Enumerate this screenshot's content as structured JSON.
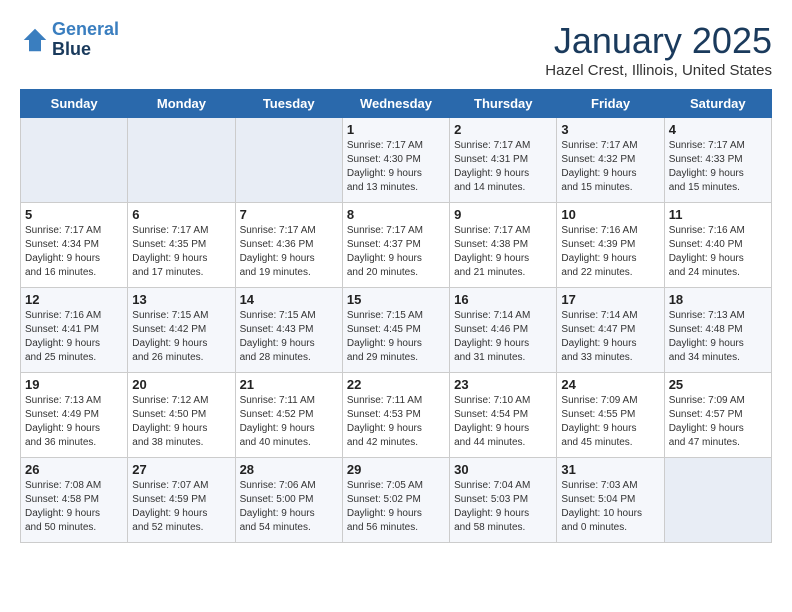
{
  "header": {
    "logo_line1": "General",
    "logo_line2": "Blue",
    "month": "January 2025",
    "location": "Hazel Crest, Illinois, United States"
  },
  "days_of_week": [
    "Sunday",
    "Monday",
    "Tuesday",
    "Wednesday",
    "Thursday",
    "Friday",
    "Saturday"
  ],
  "weeks": [
    [
      {
        "day": "",
        "info": ""
      },
      {
        "day": "",
        "info": ""
      },
      {
        "day": "",
        "info": ""
      },
      {
        "day": "1",
        "info": "Sunrise: 7:17 AM\nSunset: 4:30 PM\nDaylight: 9 hours\nand 13 minutes."
      },
      {
        "day": "2",
        "info": "Sunrise: 7:17 AM\nSunset: 4:31 PM\nDaylight: 9 hours\nand 14 minutes."
      },
      {
        "day": "3",
        "info": "Sunrise: 7:17 AM\nSunset: 4:32 PM\nDaylight: 9 hours\nand 15 minutes."
      },
      {
        "day": "4",
        "info": "Sunrise: 7:17 AM\nSunset: 4:33 PM\nDaylight: 9 hours\nand 15 minutes."
      }
    ],
    [
      {
        "day": "5",
        "info": "Sunrise: 7:17 AM\nSunset: 4:34 PM\nDaylight: 9 hours\nand 16 minutes."
      },
      {
        "day": "6",
        "info": "Sunrise: 7:17 AM\nSunset: 4:35 PM\nDaylight: 9 hours\nand 17 minutes."
      },
      {
        "day": "7",
        "info": "Sunrise: 7:17 AM\nSunset: 4:36 PM\nDaylight: 9 hours\nand 19 minutes."
      },
      {
        "day": "8",
        "info": "Sunrise: 7:17 AM\nSunset: 4:37 PM\nDaylight: 9 hours\nand 20 minutes."
      },
      {
        "day": "9",
        "info": "Sunrise: 7:17 AM\nSunset: 4:38 PM\nDaylight: 9 hours\nand 21 minutes."
      },
      {
        "day": "10",
        "info": "Sunrise: 7:16 AM\nSunset: 4:39 PM\nDaylight: 9 hours\nand 22 minutes."
      },
      {
        "day": "11",
        "info": "Sunrise: 7:16 AM\nSunset: 4:40 PM\nDaylight: 9 hours\nand 24 minutes."
      }
    ],
    [
      {
        "day": "12",
        "info": "Sunrise: 7:16 AM\nSunset: 4:41 PM\nDaylight: 9 hours\nand 25 minutes."
      },
      {
        "day": "13",
        "info": "Sunrise: 7:15 AM\nSunset: 4:42 PM\nDaylight: 9 hours\nand 26 minutes."
      },
      {
        "day": "14",
        "info": "Sunrise: 7:15 AM\nSunset: 4:43 PM\nDaylight: 9 hours\nand 28 minutes."
      },
      {
        "day": "15",
        "info": "Sunrise: 7:15 AM\nSunset: 4:45 PM\nDaylight: 9 hours\nand 29 minutes."
      },
      {
        "day": "16",
        "info": "Sunrise: 7:14 AM\nSunset: 4:46 PM\nDaylight: 9 hours\nand 31 minutes."
      },
      {
        "day": "17",
        "info": "Sunrise: 7:14 AM\nSunset: 4:47 PM\nDaylight: 9 hours\nand 33 minutes."
      },
      {
        "day": "18",
        "info": "Sunrise: 7:13 AM\nSunset: 4:48 PM\nDaylight: 9 hours\nand 34 minutes."
      }
    ],
    [
      {
        "day": "19",
        "info": "Sunrise: 7:13 AM\nSunset: 4:49 PM\nDaylight: 9 hours\nand 36 minutes."
      },
      {
        "day": "20",
        "info": "Sunrise: 7:12 AM\nSunset: 4:50 PM\nDaylight: 9 hours\nand 38 minutes."
      },
      {
        "day": "21",
        "info": "Sunrise: 7:11 AM\nSunset: 4:52 PM\nDaylight: 9 hours\nand 40 minutes."
      },
      {
        "day": "22",
        "info": "Sunrise: 7:11 AM\nSunset: 4:53 PM\nDaylight: 9 hours\nand 42 minutes."
      },
      {
        "day": "23",
        "info": "Sunrise: 7:10 AM\nSunset: 4:54 PM\nDaylight: 9 hours\nand 44 minutes."
      },
      {
        "day": "24",
        "info": "Sunrise: 7:09 AM\nSunset: 4:55 PM\nDaylight: 9 hours\nand 45 minutes."
      },
      {
        "day": "25",
        "info": "Sunrise: 7:09 AM\nSunset: 4:57 PM\nDaylight: 9 hours\nand 47 minutes."
      }
    ],
    [
      {
        "day": "26",
        "info": "Sunrise: 7:08 AM\nSunset: 4:58 PM\nDaylight: 9 hours\nand 50 minutes."
      },
      {
        "day": "27",
        "info": "Sunrise: 7:07 AM\nSunset: 4:59 PM\nDaylight: 9 hours\nand 52 minutes."
      },
      {
        "day": "28",
        "info": "Sunrise: 7:06 AM\nSunset: 5:00 PM\nDaylight: 9 hours\nand 54 minutes."
      },
      {
        "day": "29",
        "info": "Sunrise: 7:05 AM\nSunset: 5:02 PM\nDaylight: 9 hours\nand 56 minutes."
      },
      {
        "day": "30",
        "info": "Sunrise: 7:04 AM\nSunset: 5:03 PM\nDaylight: 9 hours\nand 58 minutes."
      },
      {
        "day": "31",
        "info": "Sunrise: 7:03 AM\nSunset: 5:04 PM\nDaylight: 10 hours\nand 0 minutes."
      },
      {
        "day": "",
        "info": ""
      }
    ]
  ]
}
